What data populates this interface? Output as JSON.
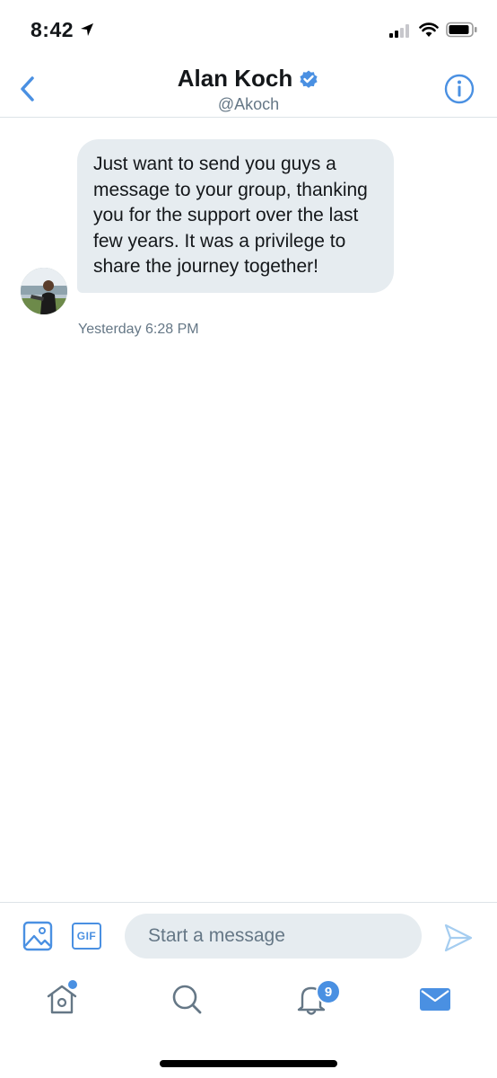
{
  "status_bar": {
    "time": "8:42"
  },
  "header": {
    "name": "Alan Koch",
    "handle": "@Akoch",
    "verified_icon": "verified-badge-icon",
    "back_icon": "chevron-left-icon",
    "info_icon": "info-icon"
  },
  "conversation": {
    "messages": [
      {
        "text": "Just want to send you guys a message to your group, thanking you for the support over the last few years. It was a privilege to share the journey together!",
        "timestamp": "Yesterday 6:28 PM"
      }
    ]
  },
  "composer": {
    "placeholder": "Start a message",
    "gif_label": "GIF"
  },
  "tabbar": {
    "notifications_count": "9"
  },
  "colors": {
    "accent": "#4a90e2",
    "bubble": "#e6ecf0",
    "secondary_text": "#657786"
  }
}
